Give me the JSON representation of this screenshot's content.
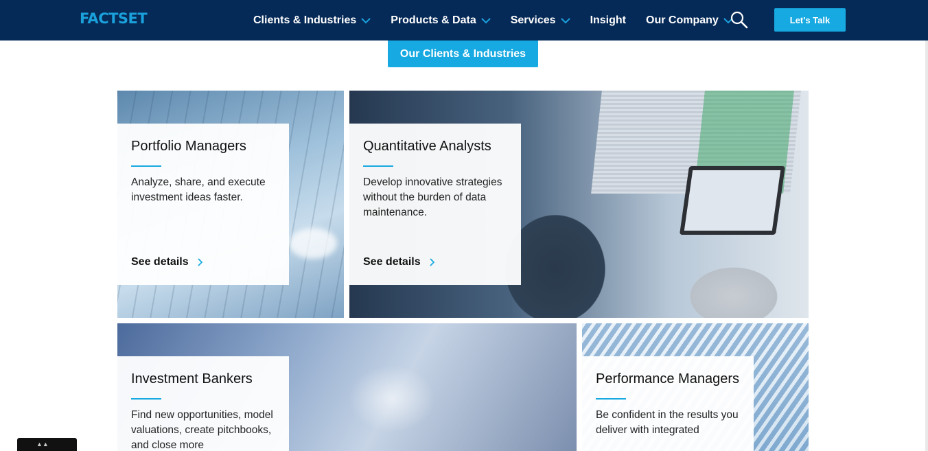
{
  "header": {
    "logo": "FACTSET",
    "nav": [
      {
        "label": "Clients & Industries",
        "dropdown": true
      },
      {
        "label": "Products & Data",
        "dropdown": true
      },
      {
        "label": "Services",
        "dropdown": true
      },
      {
        "label": "Insight",
        "dropdown": false
      },
      {
        "label": "Our Company",
        "dropdown": true
      }
    ],
    "search_icon": "search-icon",
    "cta": "Let's Talk"
  },
  "clients_button": "Our Clients & Industries",
  "tiles": [
    {
      "title": "Portfolio Managers",
      "text": "Analyze, share, and execute investment ideas faster.",
      "link": "See details"
    },
    {
      "title": "Quantitative Analysts",
      "text": "Develop innovative strategies without the burden of data maintenance.",
      "link": "See details"
    },
    {
      "title": "Investment Bankers",
      "text": "Find new opportunities, model valuations, create pitchbooks, and close more"
    },
    {
      "title": "Performance Managers",
      "text": "Be confident in the results you deliver with integrated"
    }
  ],
  "colors": {
    "nav_bg": "#062a57",
    "accent": "#17a9e1",
    "logo": "#1aa1dc"
  }
}
